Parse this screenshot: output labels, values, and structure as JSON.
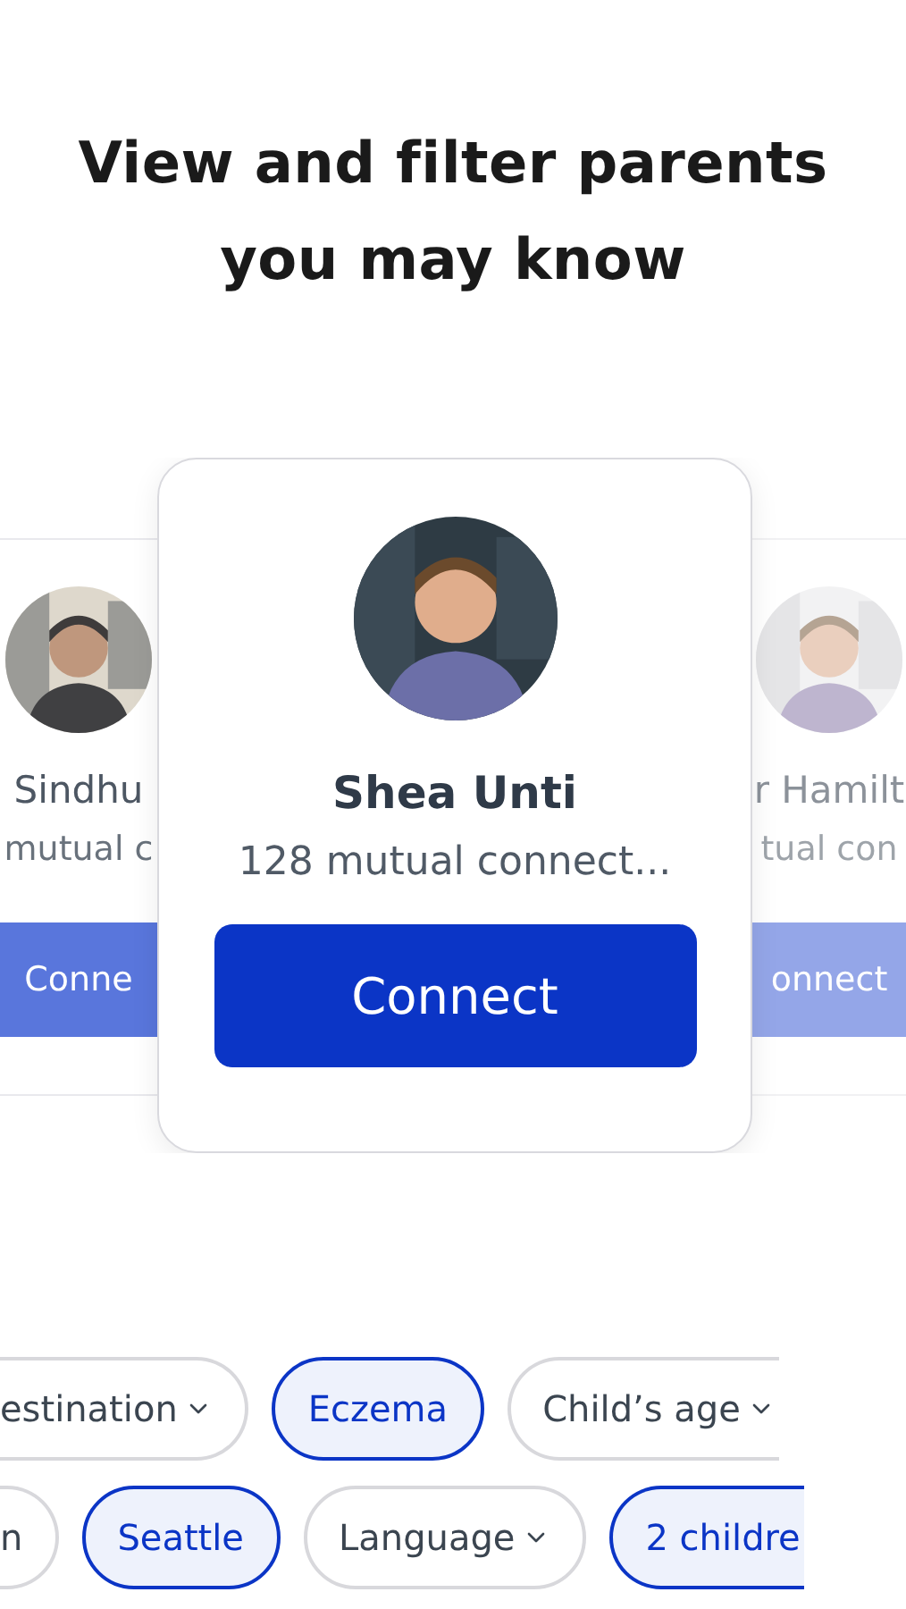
{
  "heading": "View and filter parents you may know",
  "cards": [
    {
      "kind": "left",
      "name": "Sindhu",
      "subtitle": "mutual c",
      "button": "Conne"
    },
    {
      "kind": "center",
      "name": "Shea Unti",
      "subtitle": "128 mutual connect...",
      "button": "Connect"
    },
    {
      "kind": "right",
      "name": "r Hamilt",
      "subtitle": "tual con",
      "button": "onnect"
    }
  ],
  "filter_rows": [
    [
      {
        "label": "estination",
        "selected": false,
        "dropdown": true,
        "kind": "leftcut"
      },
      {
        "label": "Eczema",
        "selected": true,
        "dropdown": false,
        "kind": "whole"
      },
      {
        "label": "Child’s age",
        "selected": false,
        "dropdown": true,
        "kind": "rightcut"
      }
    ],
    [
      {
        "label": "n",
        "selected": false,
        "dropdown": false,
        "kind": "leftcut"
      },
      {
        "label": "Seattle",
        "selected": true,
        "dropdown": false,
        "kind": "whole"
      },
      {
        "label": "Language",
        "selected": false,
        "dropdown": true,
        "kind": "whole"
      },
      {
        "label": "2 childre",
        "selected": true,
        "dropdown": false,
        "kind": "rightcut"
      }
    ]
  ]
}
